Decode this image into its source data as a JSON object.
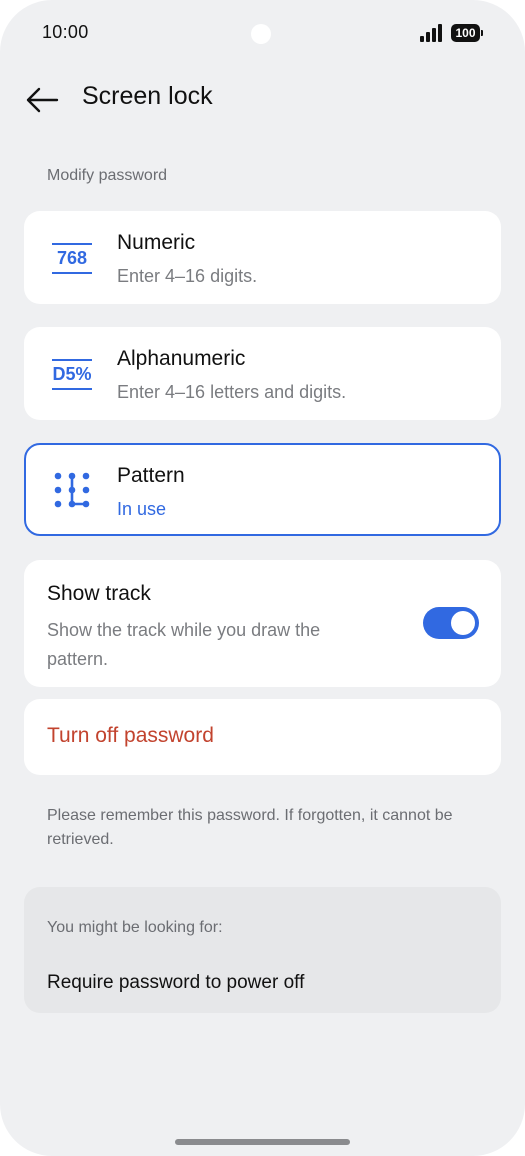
{
  "status_bar": {
    "time": "10:00",
    "battery": "100"
  },
  "header": {
    "title": "Screen lock"
  },
  "section_label": "Modify password",
  "options": [
    {
      "title": "Numeric",
      "subtitle": "Enter 4–16 digits.",
      "icon_text": "768",
      "icon": "numeric-icon"
    },
    {
      "title": "Alphanumeric",
      "subtitle": "Enter 4–16 letters and digits.",
      "icon_text": "D5%",
      "icon": "alphanumeric-icon"
    },
    {
      "title": "Pattern",
      "subtitle": "In use",
      "icon": "pattern-icon",
      "selected": true
    }
  ],
  "show_track": {
    "title": "Show track",
    "subtitle_line1": "Show the track while you draw the",
    "subtitle_line2": "pattern.",
    "enabled": true
  },
  "turn_off": {
    "label": "Turn off password",
    "color": "#c2432e"
  },
  "note": "Please remember this password. If forgotten, it cannot be retrieved.",
  "suggestions": {
    "title": "You might be looking for:",
    "items": [
      "Require password to power off"
    ]
  },
  "colors": {
    "accent": "#3169e1",
    "background": "#eff0f2",
    "danger": "#c2432e"
  }
}
